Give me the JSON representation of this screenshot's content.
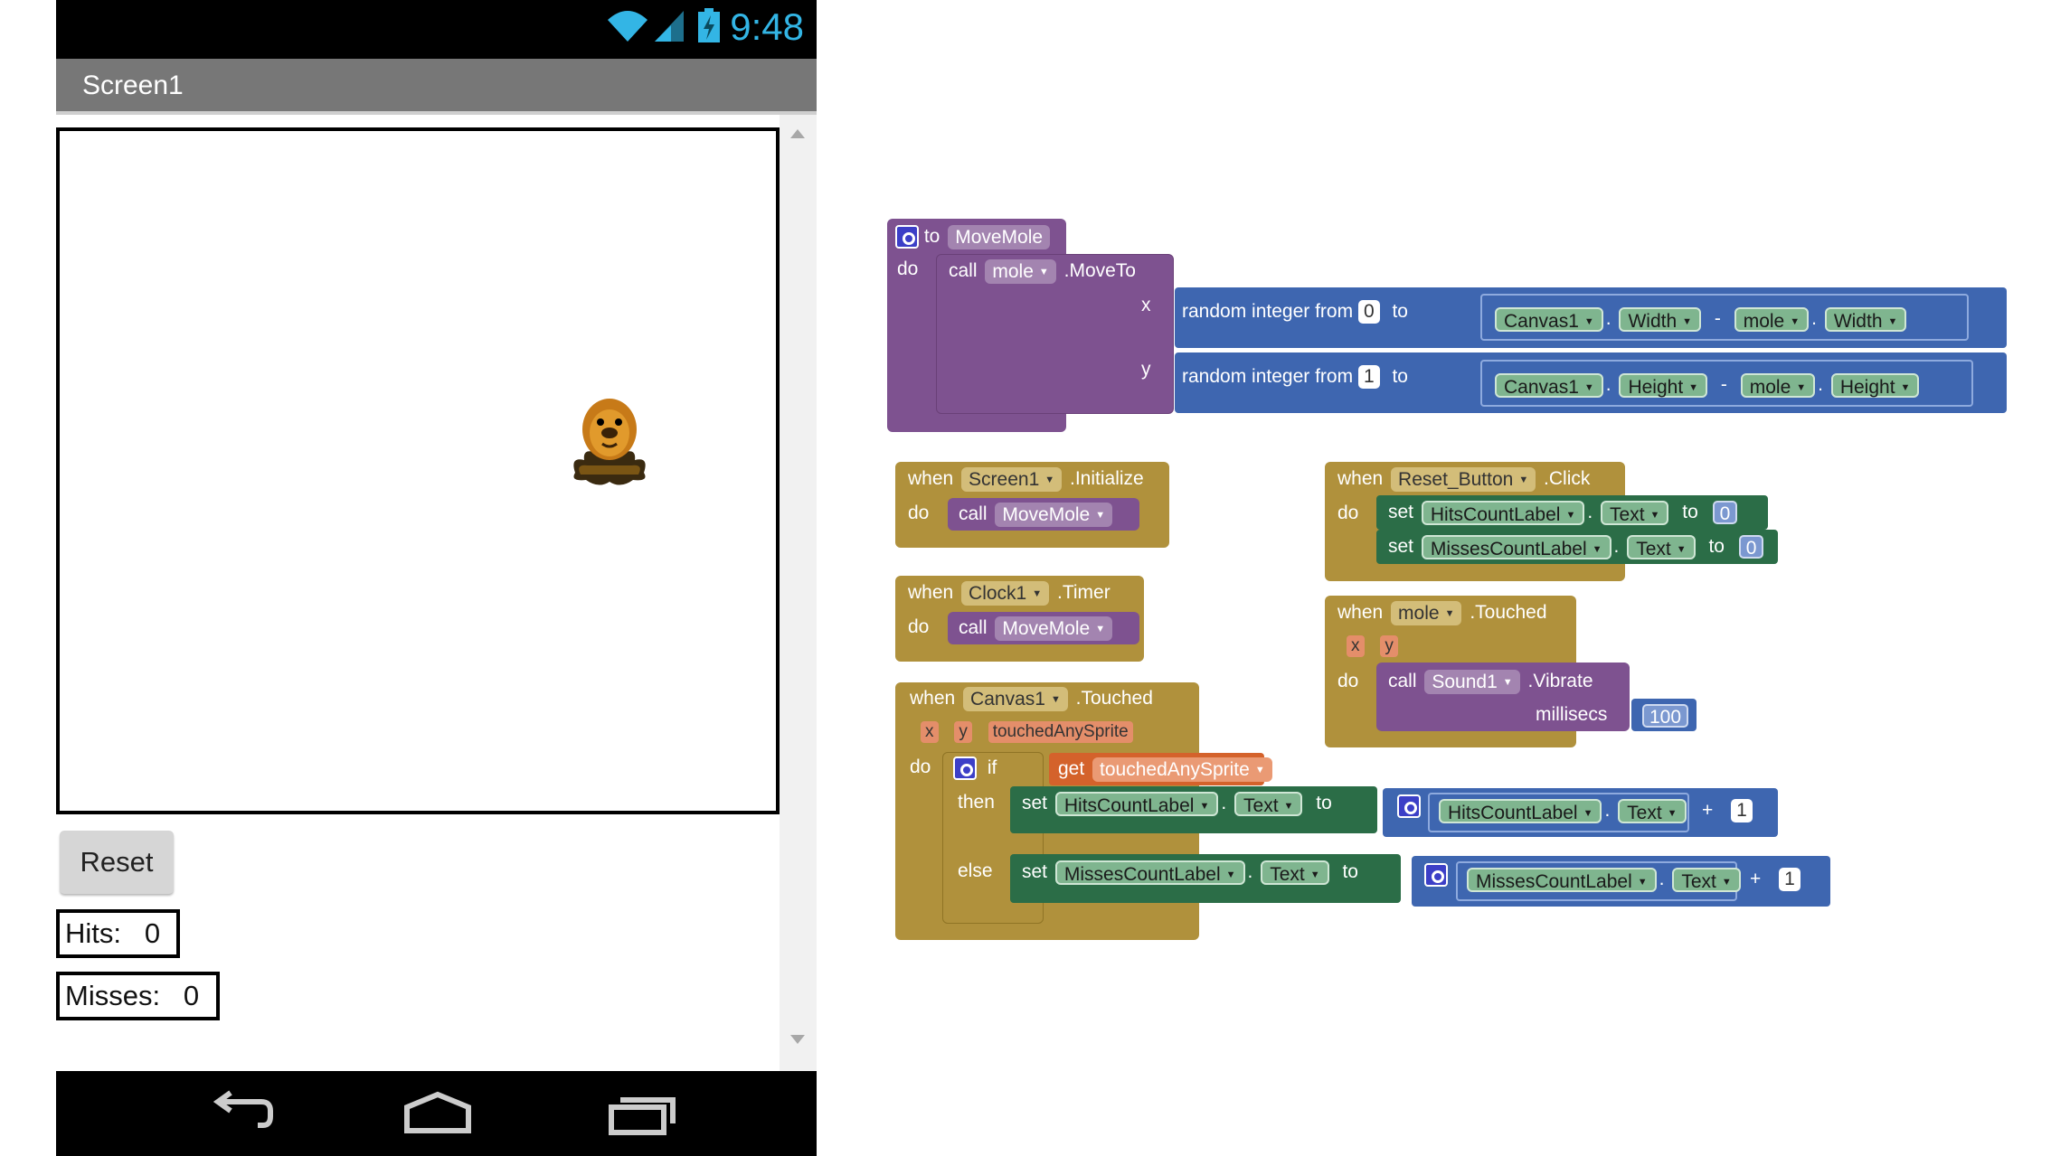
{
  "status_bar": {
    "time": "9:48",
    "icons": [
      "wifi-icon",
      "signal-icon",
      "battery-icon"
    ]
  },
  "screen": {
    "title": "Screen1"
  },
  "app": {
    "reset_label": "Reset",
    "hits_label": "Hits:   0",
    "misses_label": "Misses:   0"
  },
  "navigation": {
    "icons": [
      "back-icon",
      "home-icon",
      "recent-apps-icon"
    ]
  },
  "colors": {
    "procedure": "#7e5290",
    "event": "#b0913c",
    "setter": "#2b6d47",
    "math": "#3e66b0",
    "variable": "#d4622b",
    "status_accent": "#33b5e5"
  },
  "blocks": {
    "movemole": {
      "to": "to",
      "name": "MoveMole",
      "do": "do",
      "call": "call",
      "component": "mole",
      "method": ".MoveTo",
      "x": "x",
      "y": "y",
      "rand1": "random integer from",
      "from1": "0",
      "to1": "to",
      "c1": "Canvas1",
      "p1": "Width",
      "minus1": "-",
      "m1": "mole",
      "mp1": "Width",
      "rand2": "random integer from",
      "from2": "1",
      "to2": "to",
      "c2": "Canvas1",
      "p2": "Height",
      "minus2": "-",
      "m2": "mole",
      "mp2": "Height"
    },
    "init": {
      "when": "when",
      "component": "Screen1",
      "event": ".Initialize",
      "do": "do",
      "call": "call",
      "proc": "MoveMole"
    },
    "timer": {
      "when": "when",
      "component": "Clock1",
      "event": ".Timer",
      "do": "do",
      "call": "call",
      "proc": "MoveMole"
    },
    "canvas": {
      "when": "when",
      "component": "Canvas1",
      "event": ".Touched",
      "px": "x",
      "py": "y",
      "ptouched": "touchedAnySprite",
      "do": "do",
      "if": "if",
      "get": "get",
      "getvar": "touchedAnySprite",
      "then": "then",
      "set1": "set",
      "lbl1": "HitsCountLabel",
      "prop1": "Text",
      "to1": "to",
      "r1": "HitsCountLabel",
      "rp1": "Text",
      "plus1": "+",
      "n1": "1",
      "else": "else",
      "set2": "set",
      "lbl2": "MissesCountLabel",
      "prop2": "Text",
      "to2": "to",
      "r2": "MissesCountLabel",
      "rp2": "Text",
      "plus2": "+",
      "n2": "1"
    },
    "reset": {
      "when": "when",
      "component": "Reset_Button",
      "event": ".Click",
      "do": "do",
      "set1": "set",
      "lbl1": "HitsCountLabel",
      "prop1": "Text",
      "to1": "to",
      "v1": "0",
      "set2": "set",
      "lbl2": "MissesCountLabel",
      "prop2": "Text",
      "to2": "to",
      "v2": "0"
    },
    "touched": {
      "when": "when",
      "component": "mole",
      "event": ".Touched",
      "px": "x",
      "py": "y",
      "do": "do",
      "call": "call",
      "sound": "Sound1",
      "method": ".Vibrate",
      "arg": "millisecs",
      "val": "100"
    }
  }
}
